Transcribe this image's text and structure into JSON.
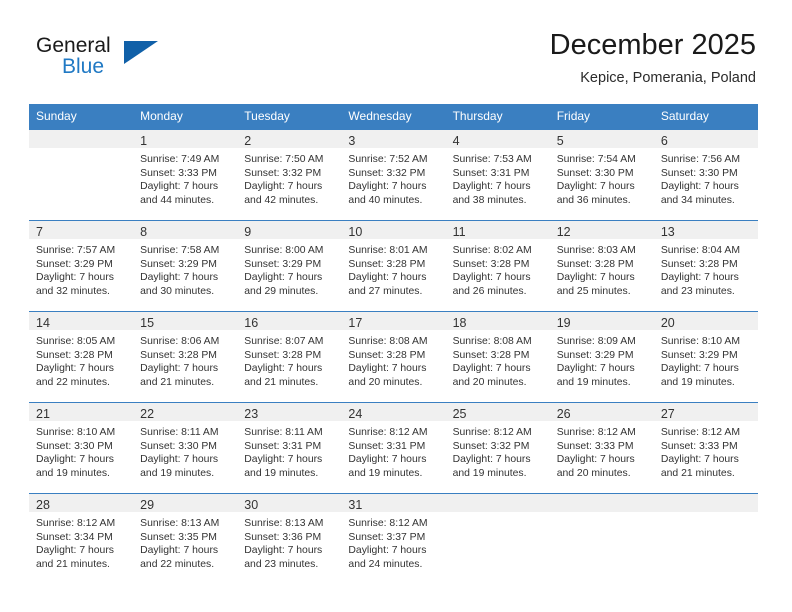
{
  "brand": {
    "name_top": "General",
    "name_bottom": "Blue",
    "triangle_color": "#1060a8",
    "blue_color": "#2079c4"
  },
  "header": {
    "title": "December 2025",
    "subtitle": "Kepice, Pomerania, Poland"
  },
  "theme": {
    "header_row_bg": "#3a7fc1",
    "daynum_bg": "#f0f0f0",
    "grid_line": "#3a7fc1",
    "text": "#333333"
  },
  "weekday_headers": [
    "Sunday",
    "Monday",
    "Tuesday",
    "Wednesday",
    "Thursday",
    "Friday",
    "Saturday"
  ],
  "weeks": [
    [
      {
        "day": "",
        "sunrise": "",
        "sunset": "",
        "daylight_line1": "",
        "daylight_line2": ""
      },
      {
        "day": "1",
        "sunrise": "Sunrise: 7:49 AM",
        "sunset": "Sunset: 3:33 PM",
        "daylight_line1": "Daylight: 7 hours",
        "daylight_line2": "and 44 minutes."
      },
      {
        "day": "2",
        "sunrise": "Sunrise: 7:50 AM",
        "sunset": "Sunset: 3:32 PM",
        "daylight_line1": "Daylight: 7 hours",
        "daylight_line2": "and 42 minutes."
      },
      {
        "day": "3",
        "sunrise": "Sunrise: 7:52 AM",
        "sunset": "Sunset: 3:32 PM",
        "daylight_line1": "Daylight: 7 hours",
        "daylight_line2": "and 40 minutes."
      },
      {
        "day": "4",
        "sunrise": "Sunrise: 7:53 AM",
        "sunset": "Sunset: 3:31 PM",
        "daylight_line1": "Daylight: 7 hours",
        "daylight_line2": "and 38 minutes."
      },
      {
        "day": "5",
        "sunrise": "Sunrise: 7:54 AM",
        "sunset": "Sunset: 3:30 PM",
        "daylight_line1": "Daylight: 7 hours",
        "daylight_line2": "and 36 minutes."
      },
      {
        "day": "6",
        "sunrise": "Sunrise: 7:56 AM",
        "sunset": "Sunset: 3:30 PM",
        "daylight_line1": "Daylight: 7 hours",
        "daylight_line2": "and 34 minutes."
      }
    ],
    [
      {
        "day": "7",
        "sunrise": "Sunrise: 7:57 AM",
        "sunset": "Sunset: 3:29 PM",
        "daylight_line1": "Daylight: 7 hours",
        "daylight_line2": "and 32 minutes."
      },
      {
        "day": "8",
        "sunrise": "Sunrise: 7:58 AM",
        "sunset": "Sunset: 3:29 PM",
        "daylight_line1": "Daylight: 7 hours",
        "daylight_line2": "and 30 minutes."
      },
      {
        "day": "9",
        "sunrise": "Sunrise: 8:00 AM",
        "sunset": "Sunset: 3:29 PM",
        "daylight_line1": "Daylight: 7 hours",
        "daylight_line2": "and 29 minutes."
      },
      {
        "day": "10",
        "sunrise": "Sunrise: 8:01 AM",
        "sunset": "Sunset: 3:28 PM",
        "daylight_line1": "Daylight: 7 hours",
        "daylight_line2": "and 27 minutes."
      },
      {
        "day": "11",
        "sunrise": "Sunrise: 8:02 AM",
        "sunset": "Sunset: 3:28 PM",
        "daylight_line1": "Daylight: 7 hours",
        "daylight_line2": "and 26 minutes."
      },
      {
        "day": "12",
        "sunrise": "Sunrise: 8:03 AM",
        "sunset": "Sunset: 3:28 PM",
        "daylight_line1": "Daylight: 7 hours",
        "daylight_line2": "and 25 minutes."
      },
      {
        "day": "13",
        "sunrise": "Sunrise: 8:04 AM",
        "sunset": "Sunset: 3:28 PM",
        "daylight_line1": "Daylight: 7 hours",
        "daylight_line2": "and 23 minutes."
      }
    ],
    [
      {
        "day": "14",
        "sunrise": "Sunrise: 8:05 AM",
        "sunset": "Sunset: 3:28 PM",
        "daylight_line1": "Daylight: 7 hours",
        "daylight_line2": "and 22 minutes."
      },
      {
        "day": "15",
        "sunrise": "Sunrise: 8:06 AM",
        "sunset": "Sunset: 3:28 PM",
        "daylight_line1": "Daylight: 7 hours",
        "daylight_line2": "and 21 minutes."
      },
      {
        "day": "16",
        "sunrise": "Sunrise: 8:07 AM",
        "sunset": "Sunset: 3:28 PM",
        "daylight_line1": "Daylight: 7 hours",
        "daylight_line2": "and 21 minutes."
      },
      {
        "day": "17",
        "sunrise": "Sunrise: 8:08 AM",
        "sunset": "Sunset: 3:28 PM",
        "daylight_line1": "Daylight: 7 hours",
        "daylight_line2": "and 20 minutes."
      },
      {
        "day": "18",
        "sunrise": "Sunrise: 8:08 AM",
        "sunset": "Sunset: 3:28 PM",
        "daylight_line1": "Daylight: 7 hours",
        "daylight_line2": "and 20 minutes."
      },
      {
        "day": "19",
        "sunrise": "Sunrise: 8:09 AM",
        "sunset": "Sunset: 3:29 PM",
        "daylight_line1": "Daylight: 7 hours",
        "daylight_line2": "and 19 minutes."
      },
      {
        "day": "20",
        "sunrise": "Sunrise: 8:10 AM",
        "sunset": "Sunset: 3:29 PM",
        "daylight_line1": "Daylight: 7 hours",
        "daylight_line2": "and 19 minutes."
      }
    ],
    [
      {
        "day": "21",
        "sunrise": "Sunrise: 8:10 AM",
        "sunset": "Sunset: 3:30 PM",
        "daylight_line1": "Daylight: 7 hours",
        "daylight_line2": "and 19 minutes."
      },
      {
        "day": "22",
        "sunrise": "Sunrise: 8:11 AM",
        "sunset": "Sunset: 3:30 PM",
        "daylight_line1": "Daylight: 7 hours",
        "daylight_line2": "and 19 minutes."
      },
      {
        "day": "23",
        "sunrise": "Sunrise: 8:11 AM",
        "sunset": "Sunset: 3:31 PM",
        "daylight_line1": "Daylight: 7 hours",
        "daylight_line2": "and 19 minutes."
      },
      {
        "day": "24",
        "sunrise": "Sunrise: 8:12 AM",
        "sunset": "Sunset: 3:31 PM",
        "daylight_line1": "Daylight: 7 hours",
        "daylight_line2": "and 19 minutes."
      },
      {
        "day": "25",
        "sunrise": "Sunrise: 8:12 AM",
        "sunset": "Sunset: 3:32 PM",
        "daylight_line1": "Daylight: 7 hours",
        "daylight_line2": "and 19 minutes."
      },
      {
        "day": "26",
        "sunrise": "Sunrise: 8:12 AM",
        "sunset": "Sunset: 3:33 PM",
        "daylight_line1": "Daylight: 7 hours",
        "daylight_line2": "and 20 minutes."
      },
      {
        "day": "27",
        "sunrise": "Sunrise: 8:12 AM",
        "sunset": "Sunset: 3:33 PM",
        "daylight_line1": "Daylight: 7 hours",
        "daylight_line2": "and 21 minutes."
      }
    ],
    [
      {
        "day": "28",
        "sunrise": "Sunrise: 8:12 AM",
        "sunset": "Sunset: 3:34 PM",
        "daylight_line1": "Daylight: 7 hours",
        "daylight_line2": "and 21 minutes."
      },
      {
        "day": "29",
        "sunrise": "Sunrise: 8:13 AM",
        "sunset": "Sunset: 3:35 PM",
        "daylight_line1": "Daylight: 7 hours",
        "daylight_line2": "and 22 minutes."
      },
      {
        "day": "30",
        "sunrise": "Sunrise: 8:13 AM",
        "sunset": "Sunset: 3:36 PM",
        "daylight_line1": "Daylight: 7 hours",
        "daylight_line2": "and 23 minutes."
      },
      {
        "day": "31",
        "sunrise": "Sunrise: 8:12 AM",
        "sunset": "Sunset: 3:37 PM",
        "daylight_line1": "Daylight: 7 hours",
        "daylight_line2": "and 24 minutes."
      },
      {
        "day": "",
        "sunrise": "",
        "sunset": "",
        "daylight_line1": "",
        "daylight_line2": ""
      },
      {
        "day": "",
        "sunrise": "",
        "sunset": "",
        "daylight_line1": "",
        "daylight_line2": ""
      },
      {
        "day": "",
        "sunrise": "",
        "sunset": "",
        "daylight_line1": "",
        "daylight_line2": ""
      }
    ]
  ]
}
